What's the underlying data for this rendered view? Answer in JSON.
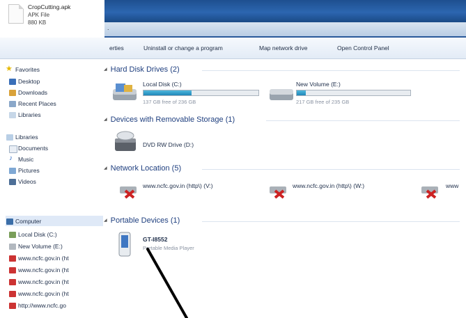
{
  "file": {
    "name": "CropCutting.apk",
    "type": "APK File",
    "size": "880 KB"
  },
  "address": ".",
  "toolbar": {
    "items": [
      "erties",
      "Uninstall or change a program",
      "Map network drive",
      "Open Control Panel"
    ]
  },
  "sidebar": {
    "favorites_header": "Favorites",
    "favorites": [
      "Desktop",
      "Downloads",
      "Recent Places",
      "Libraries"
    ],
    "libraries_header": "Libraries",
    "libraries": [
      "Documents",
      "Music",
      "Pictures",
      "Videos"
    ],
    "computer_header": "Computer",
    "computer_items": [
      "Local Disk (C:)",
      "New Volume (E:)",
      "www.ncfc.gov.in (ht",
      "www.ncfc.gov.in (ht",
      "www.ncfc.gov.in (ht",
      "www.ncfc.gov.in (ht",
      "http://www.ncfc.go"
    ]
  },
  "groups": {
    "hard_disks": {
      "header": "Hard Disk Drives (2)",
      "drives": [
        {
          "name": "Local Disk (C:)",
          "free": "137 GB free of 236 GB",
          "used_fraction": 0.42
        },
        {
          "name": "New Volume (E:)",
          "free": "217 GB free of 235 GB",
          "used_fraction": 0.08
        }
      ]
    },
    "removable": {
      "header": "Devices with Removable Storage (1)",
      "items": [
        "DVD RW Drive (D:)"
      ]
    },
    "network": {
      "header": "Network Location (5)",
      "items": [
        "www.ncfc.gov.in (http\\) (V:)",
        "www.ncfc.gov.in (http\\) (W:)",
        "www"
      ]
    },
    "portable": {
      "header": "Portable Devices (1)",
      "device_name": "GT-I8552",
      "device_type": "Portable Media Player"
    }
  },
  "colors": {
    "accent": "#1f86b8",
    "title_band": "#2c66b0",
    "group_header": "#1f3f7f",
    "net_error": "#cc2222"
  }
}
